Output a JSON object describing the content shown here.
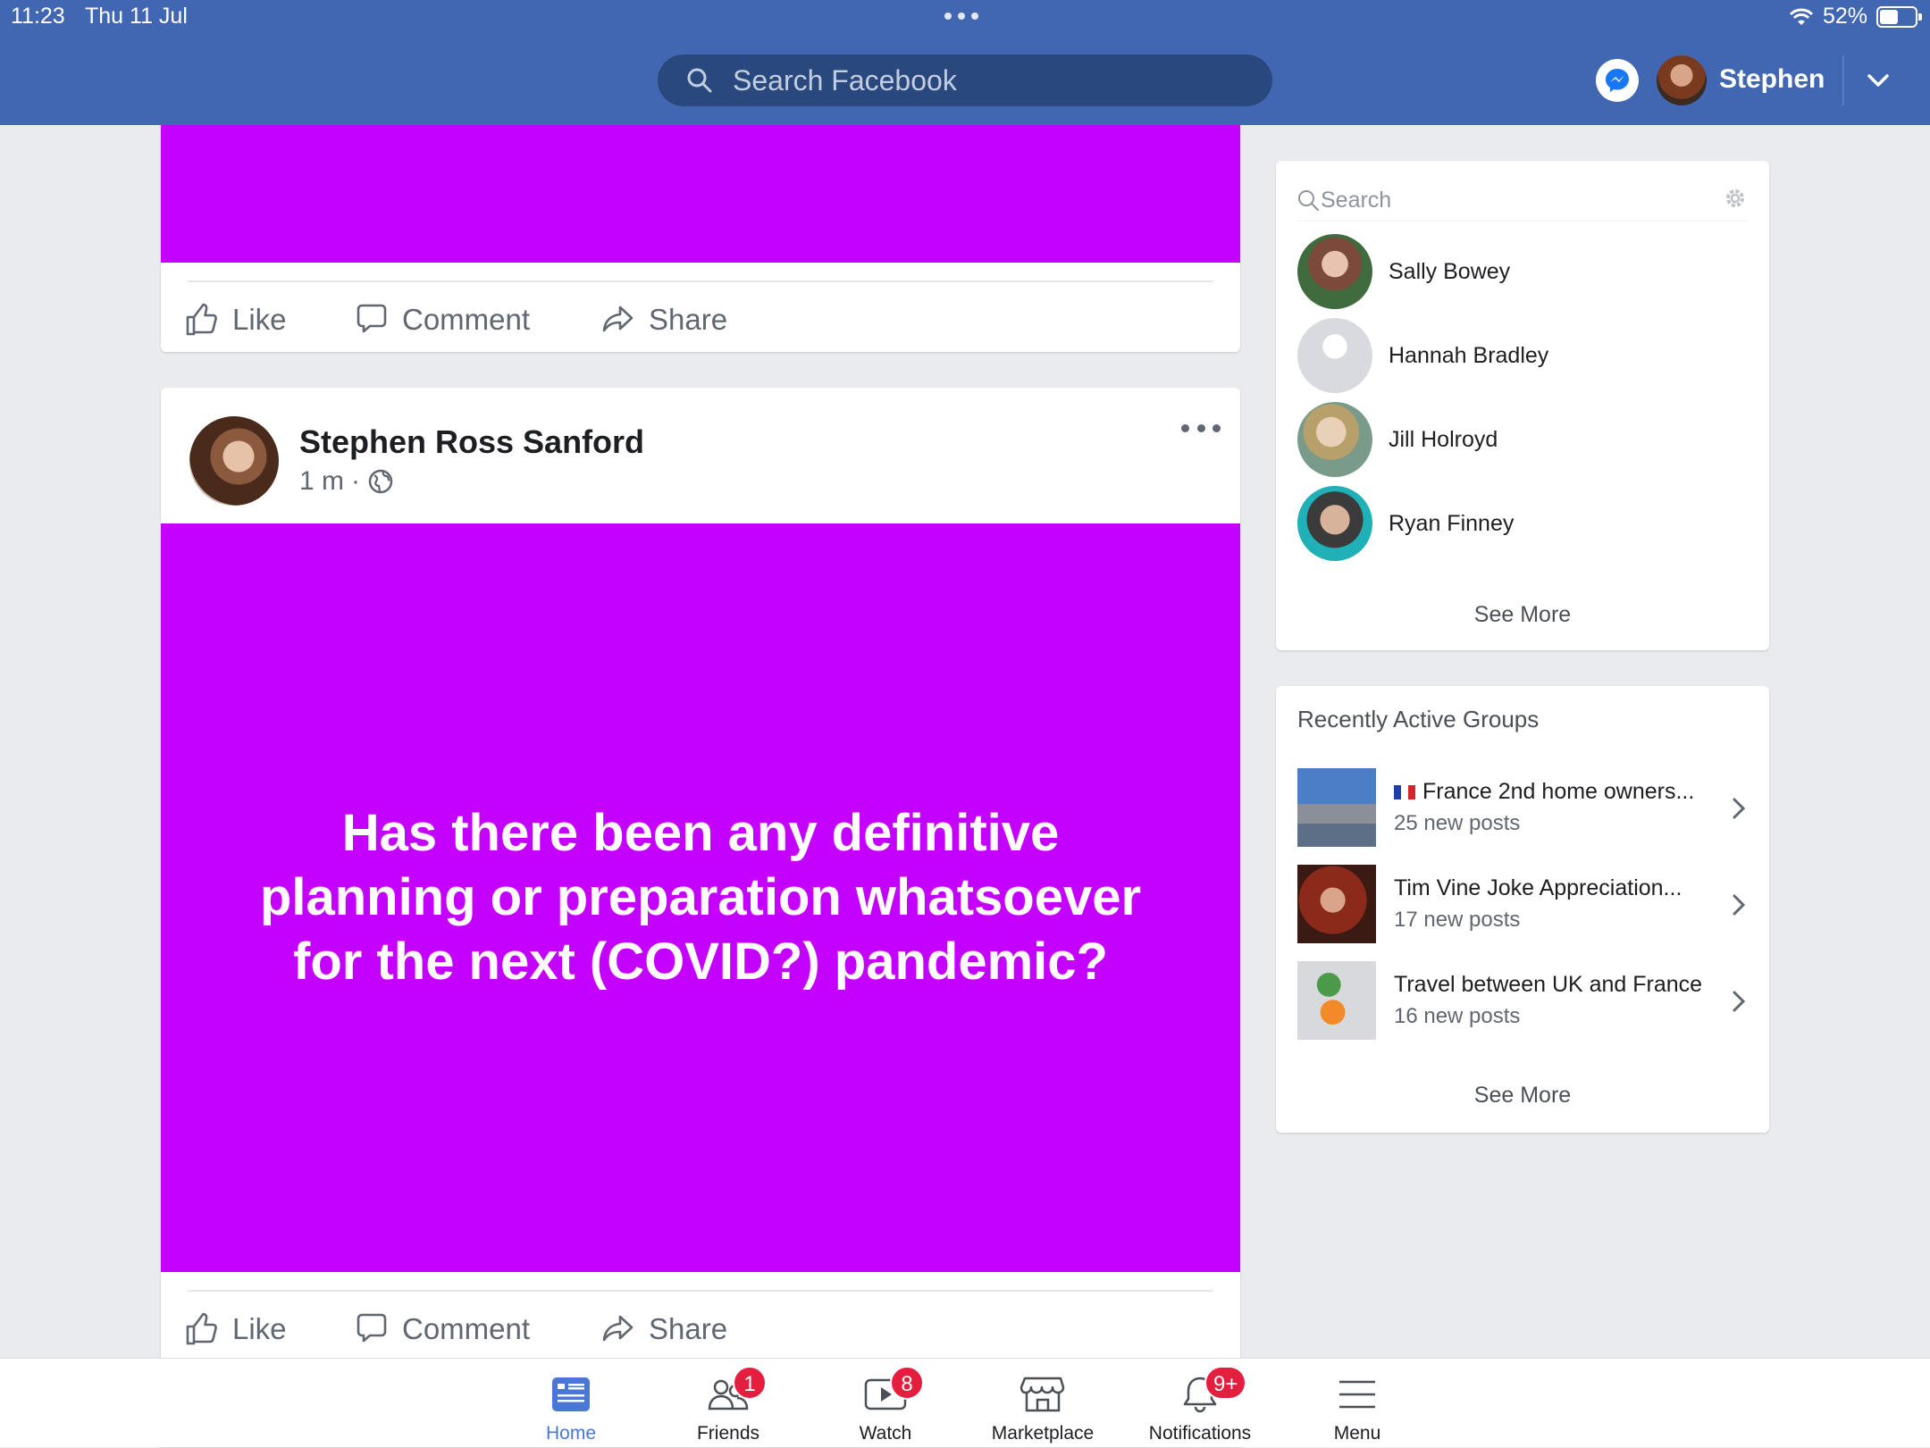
{
  "status_bar": {
    "time": "11:23",
    "date": "Thu 11 Jul",
    "battery": "52%",
    "battery_level": 0.52
  },
  "header": {
    "search_placeholder": "Search Facebook",
    "user_name": "Stephen"
  },
  "post_top": {
    "actions": {
      "like": "Like",
      "comment": "Comment",
      "share": "Share"
    },
    "background_color": "#c400ff"
  },
  "post": {
    "author": "Stephen Ross Sanford",
    "time": "1 m",
    "separator": "·",
    "text": "Has there been any definitive planning or preparation whatsoever for the next (COVID?) pandemic?",
    "background_color": "#c400ff",
    "actions": {
      "like": "Like",
      "comment": "Comment",
      "share": "Share"
    }
  },
  "contacts": {
    "search_placeholder": "Search",
    "items": [
      {
        "name": "Sally Bowey"
      },
      {
        "name": "Hannah Bradley"
      },
      {
        "name": "Jill Holroyd"
      },
      {
        "name": "Ryan Finney"
      }
    ],
    "see_more": "See More"
  },
  "groups": {
    "title": "Recently Active Groups",
    "items": [
      {
        "name": "France 2nd home owners...",
        "count": "25 new posts"
      },
      {
        "name": "Tim Vine Joke Appreciation...",
        "count": "17 new posts"
      },
      {
        "name": "Travel between UK and France",
        "count": "16 new posts"
      }
    ],
    "see_more": "See More"
  },
  "bottom_nav": {
    "tabs": [
      {
        "label": "Home",
        "badge": ""
      },
      {
        "label": "Friends",
        "badge": "1"
      },
      {
        "label": "Watch",
        "badge": "8"
      },
      {
        "label": "Marketplace",
        "badge": ""
      },
      {
        "label": "Notifications",
        "badge": "9+"
      },
      {
        "label": "Menu",
        "badge": ""
      }
    ]
  },
  "colors": {
    "brand": "#4267b2",
    "post_background": "#c400ff",
    "badge": "#e41e3f",
    "active_tab": "#4a77d6"
  }
}
